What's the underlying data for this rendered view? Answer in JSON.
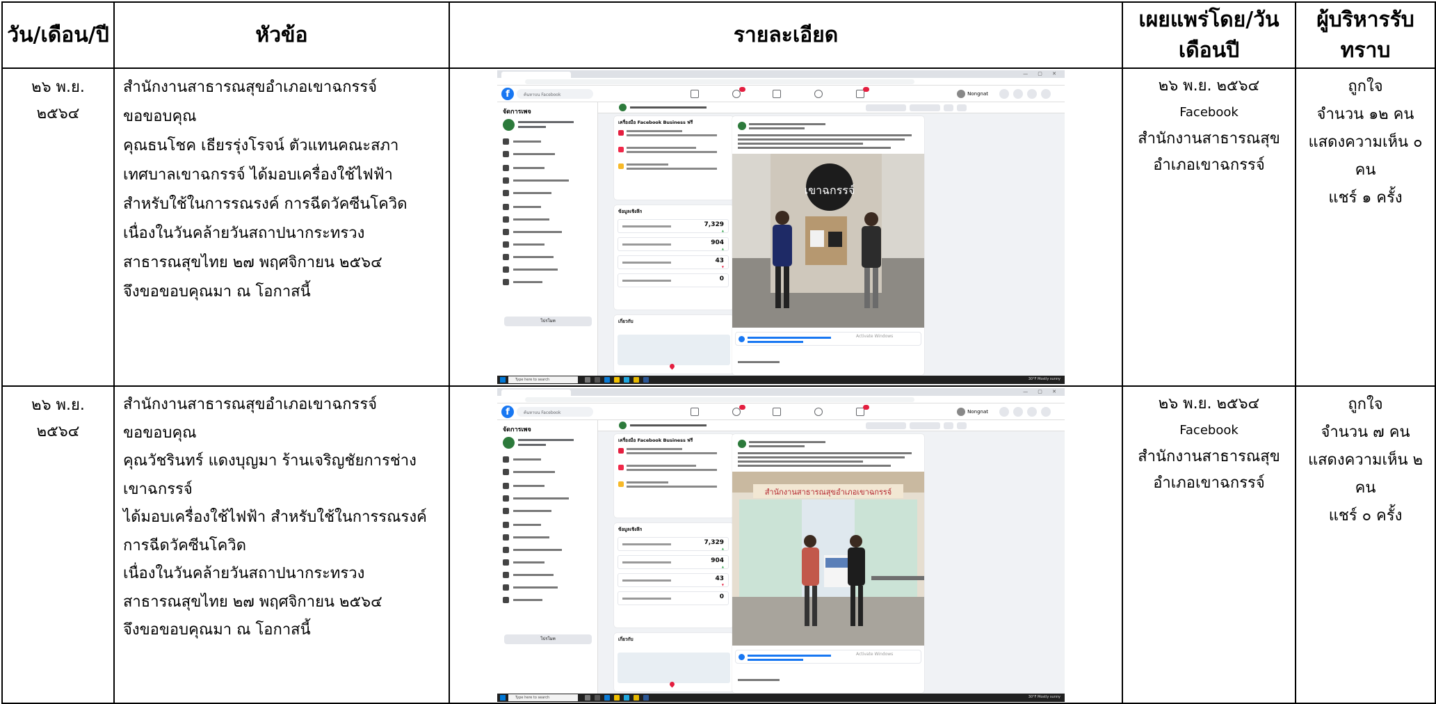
{
  "headers": {
    "date": "วัน/เดือน/ปี",
    "topic": "หัวข้อ",
    "detail": "รายละเอียด",
    "published": "เผยแพร่โดย/วันเดือนปี",
    "acknowledged": "ผู้บริหารรับทราบ"
  },
  "rows": [
    {
      "date_line1": "๒๖ พ.ย.",
      "date_line2": "๒๕๖๔",
      "subject_lines": [
        "สำนักงานสาธารณสุขอำเภอเขาฉกรรจ์",
        "ขอขอบคุณ",
        "คุณธนโชค เธียรรุ่งโรจน์ ตัวแทนคณะสภา",
        "เทศบาลเขาฉกรรจ์ ได้มอบเครื่องใช้ไฟฟ้า",
        "สำหรับใช้ในการรณรงค์ การฉีดวัคซีนโควิด",
        "เนื่องในวันคล้ายวันสถาปนากระทรวง",
        "สาธารณสุขไทย ๒๗ พฤศจิกายน ๒๕๖๔",
        "จึงขอขอบคุณมา ณ โอกาสนี้"
      ],
      "screenshot": {
        "search_placeholder": "ค้นหาบน Facebook",
        "manage_title": "จัดการเพจ",
        "user_name": "Nongnat",
        "promote_label": "โปรโมท",
        "insights_title": "ข้อมูลเชิงลึก",
        "stats": [
          "7,329",
          "904",
          "43",
          "0"
        ],
        "related_title": "เกี่ยวกับ",
        "business_title": "เครื่องมือ Facebook Business ฟรี",
        "taskbar_search": "Type here to search",
        "weather": "30°F Mostly sunny"
      },
      "pub_date": "๒๖ พ.ย. ๒๕๖๔",
      "pub_source": "Facebook",
      "pub_org_line1": "สำนักงานสาธารณสุข",
      "pub_org_line2": "อำเภอเขาฉกรรจ์",
      "ack_lines": [
        "ถูกใจ",
        "จำนวน ๑๒ คน",
        "แสดงความเห็น ๐",
        "คน",
        "แชร์ ๑ ครั้ง"
      ]
    },
    {
      "date_line1": "๒๖ พ.ย.",
      "date_line2": "๒๕๖๔",
      "subject_lines": [
        "สำนักงานสาธารณสุขอำเภอเขาฉกรรจ์",
        "ขอขอบคุณ",
        "คุณวัชรินทร์ แดงบุญมา ร้านเจริญชัยการช่าง",
        "เขาฉกรรจ์",
        "ได้มอบเครื่องใช้ไฟฟ้า สำหรับใช้ในการรณรงค์",
        "การฉีดวัคซีนโควิด",
        "เนื่องในวันคล้ายวันสถาปนากระทรวง",
        "สาธารณสุขไทย ๒๗ พฤศจิกายน ๒๕๖๔",
        "จึงขอขอบคุณมา ณ โอกาสนี้"
      ],
      "screenshot": {
        "search_placeholder": "ค้นหาบน Facebook",
        "manage_title": "จัดการเพจ",
        "user_name": "Nongnat",
        "promote_label": "โปรโมท",
        "insights_title": "ข้อมูลเชิงลึก",
        "stats": [
          "7,329",
          "904",
          "43",
          "0"
        ],
        "related_title": "เกี่ยวกับ",
        "business_title": "เครื่องมือ Facebook Business ฟรี",
        "taskbar_search": "Type here to search",
        "weather": "30°F Mostly sunny"
      },
      "pub_date": "๒๖ พ.ย. ๒๕๖๔",
      "pub_source": "Facebook",
      "pub_org_line1": "สำนักงานสาธารณสุข",
      "pub_org_line2": "อำเภอเขาฉกรรจ์",
      "ack_lines": [
        "ถูกใจ",
        "จำนวน ๗ คน",
        "แสดงความเห็น ๒",
        "คน",
        "แชร์ ๐ ครั้ง"
      ]
    }
  ]
}
